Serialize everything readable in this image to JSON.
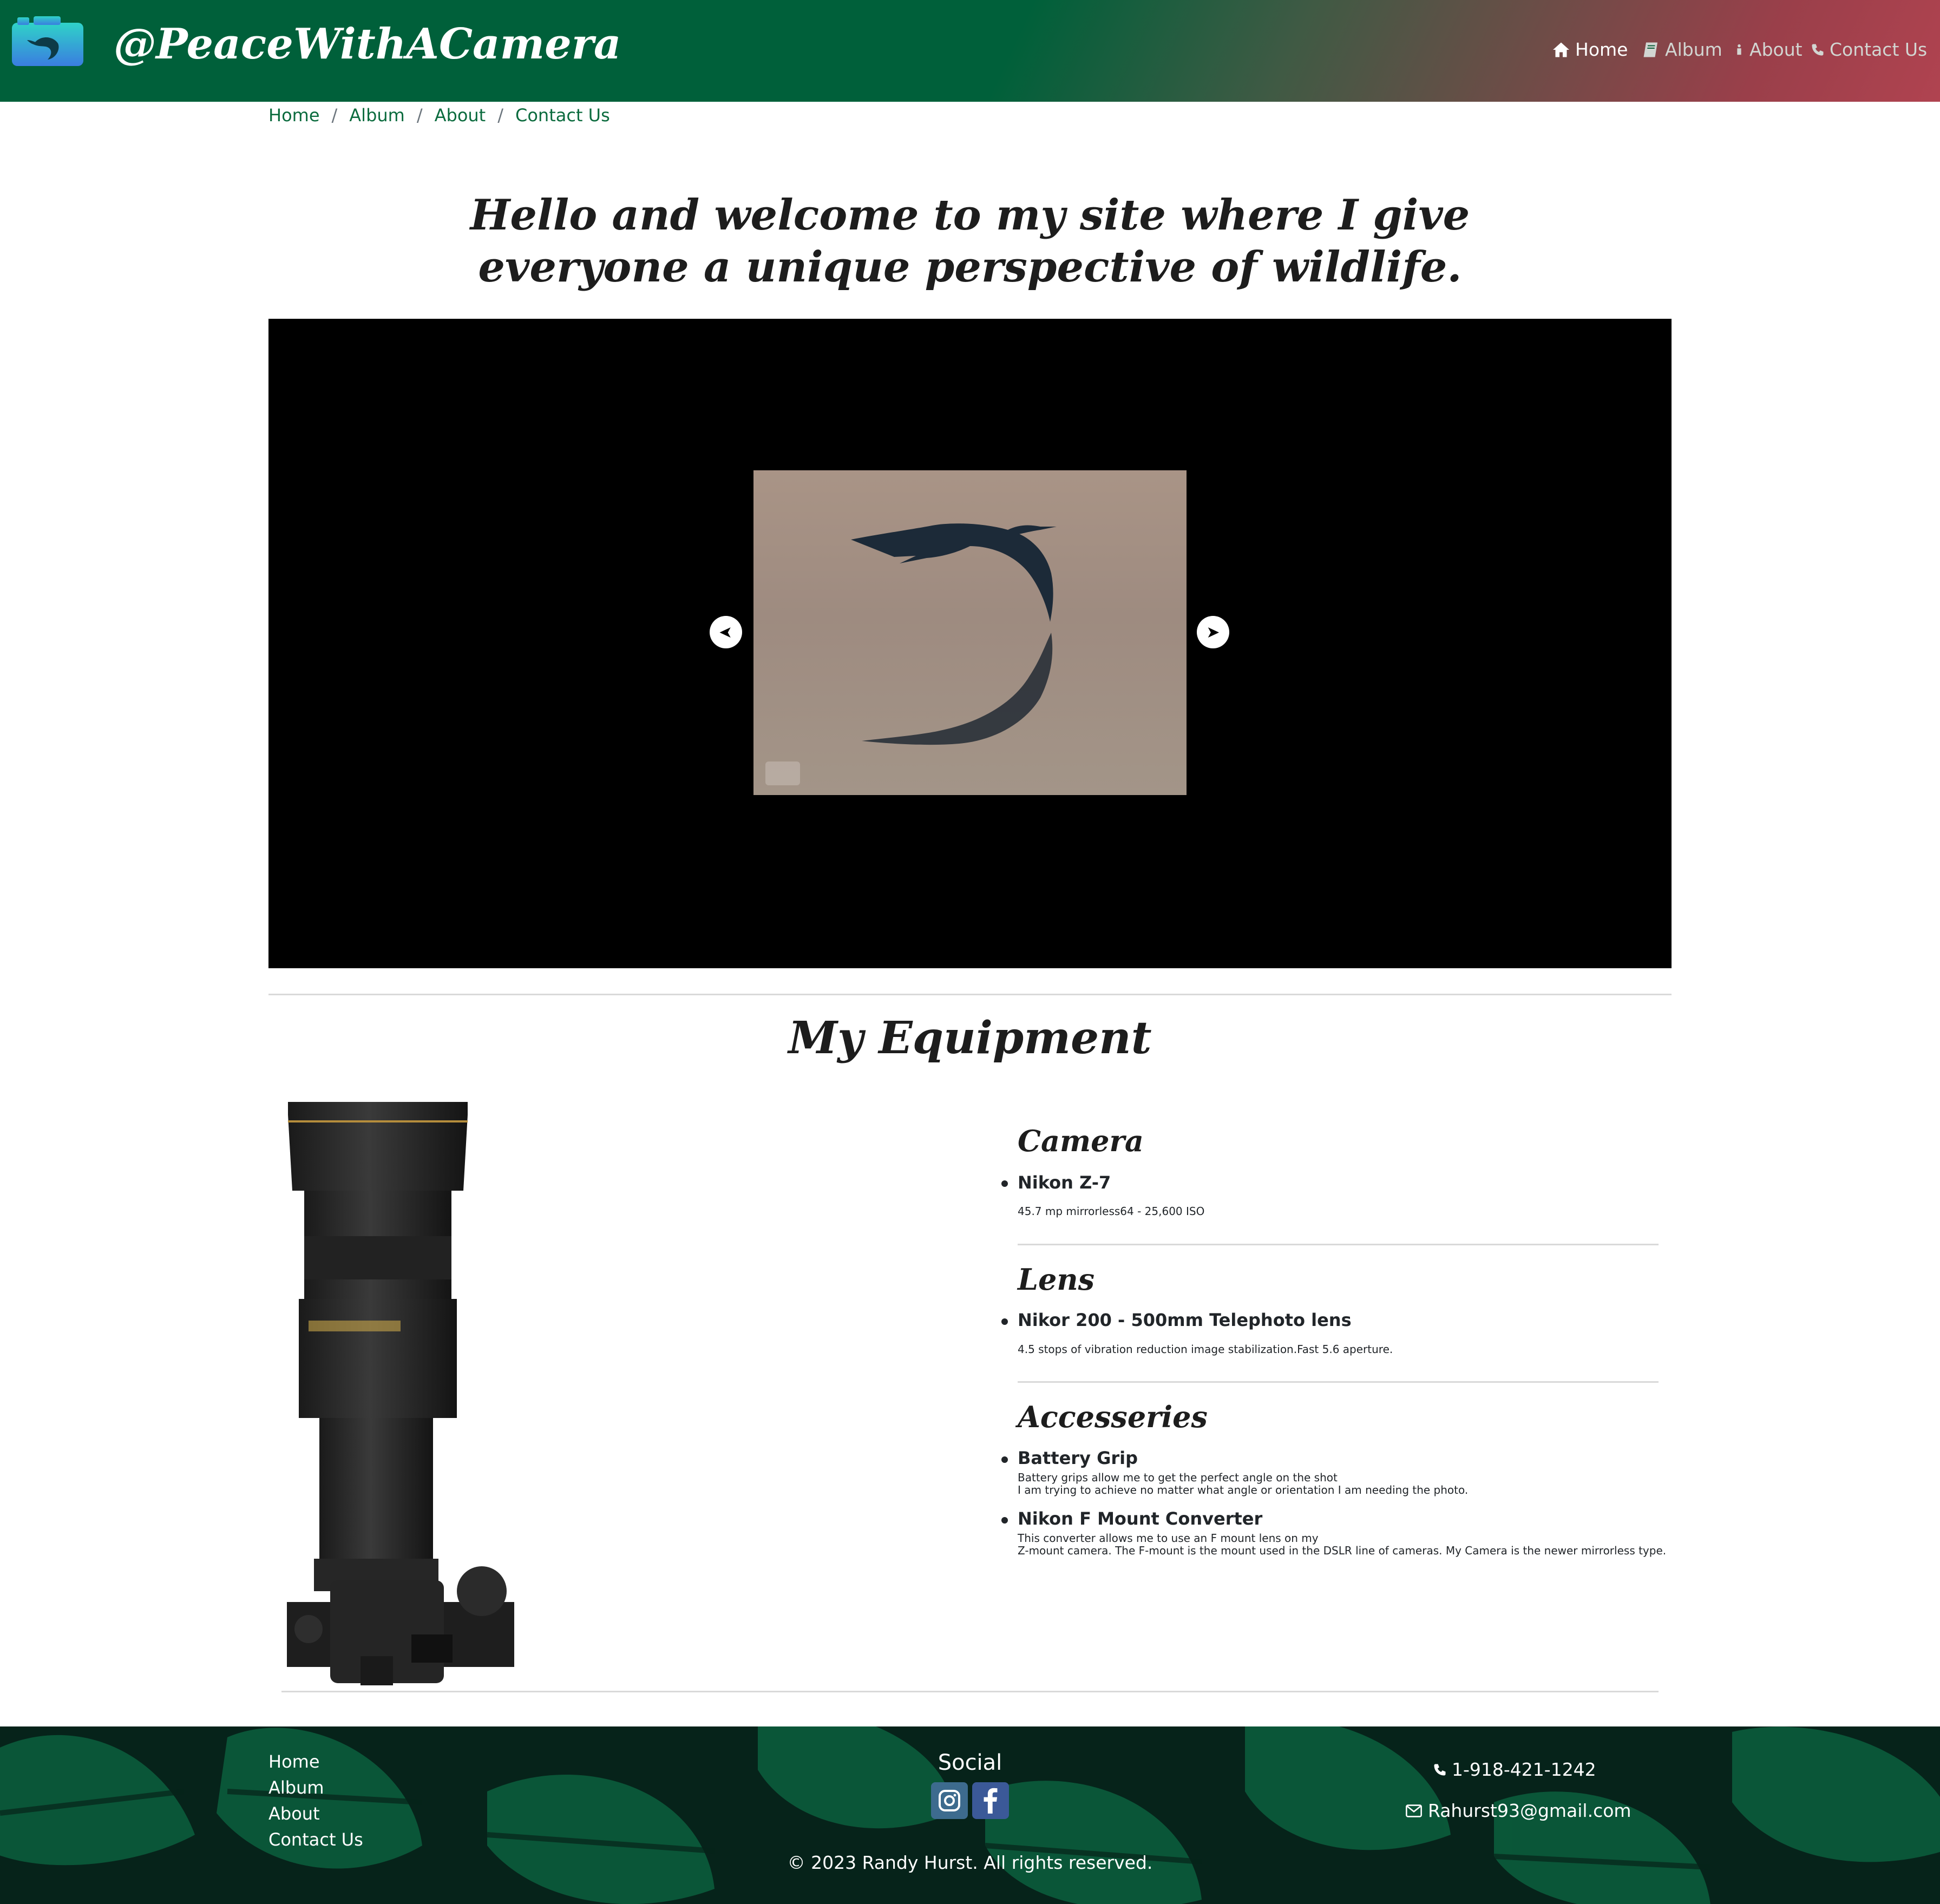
{
  "header": {
    "brand": "@PeaceWithACamera",
    "nav": [
      {
        "label": "Home",
        "icon": "home-icon",
        "active": true
      },
      {
        "label": "Album",
        "icon": "book-icon",
        "active": false
      },
      {
        "label": "About",
        "icon": "info-icon",
        "active": false
      },
      {
        "label": "Contact Us",
        "icon": "phone-icon",
        "active": false
      }
    ]
  },
  "breadcrumb": [
    "Home",
    "Album",
    "About",
    "Contact Us"
  ],
  "hero": {
    "title": "Hello and welcome to my site where I give everyone a unique perspective of wildlife."
  },
  "carousel": {
    "prev_icon": "arrow-left-icon",
    "next_icon": "arrow-right-icon",
    "prev_glyph": "➤",
    "next_glyph": "➤"
  },
  "equipment": {
    "title": "My Equipment",
    "camera": {
      "heading": "Camera",
      "item": "Nikon Z-7",
      "desc": "45.7 mp mirrorless64 - 25,600 ISO"
    },
    "lens": {
      "heading": "Lens",
      "item": "Nikor 200 - 500mm Telephoto lens",
      "desc": "4.5 stops of vibration reduction image stabilization.Fast 5.6 aperture."
    },
    "accessories": {
      "heading": "Accesseries",
      "items": [
        {
          "name": "Battery Grip",
          "desc_line1": "Battery grips allow me to get the perfect angle on the shot",
          "desc_line2": "I am trying to achieve no matter what angle or orientation I am needing the photo."
        },
        {
          "name": "Nikon F Mount Converter",
          "desc_line1": "This converter allows me to use an F mount lens on my",
          "desc_line2": "Z-mount camera. The F-mount is the mount used in the DSLR line of cameras. My Camera is the newer mirrorless type."
        }
      ]
    }
  },
  "footer": {
    "links": [
      "Home",
      "Album",
      "About",
      "Contact Us"
    ],
    "social_title": "Social",
    "social": [
      {
        "name": "Instagram",
        "icon": "instagram-icon",
        "color": "#3d6b8e"
      },
      {
        "name": "Facebook",
        "icon": "facebook-icon",
        "color": "#3b5998"
      }
    ],
    "phone": "1-918-421-1242",
    "email": "Rahurst93@gmail.com",
    "copyright": "© 2023 Randy Hurst. All rights reserved."
  },
  "colors": {
    "header_green": "#00603a",
    "header_red": "#b04350",
    "link_green": "#0b6b3e",
    "footer_dark": "#06231a"
  }
}
